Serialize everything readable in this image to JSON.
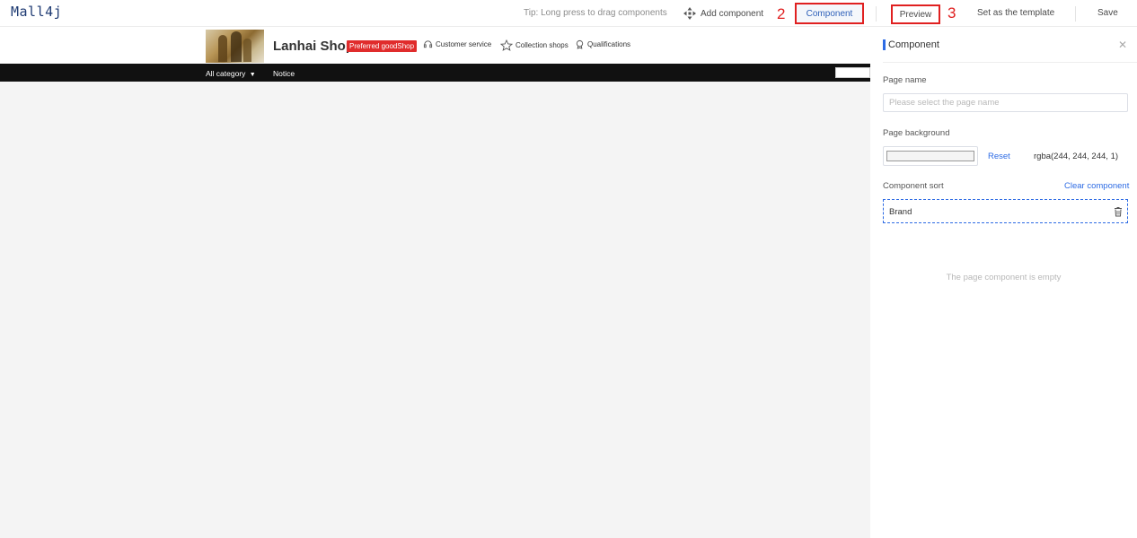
{
  "topbar": {
    "logo": "Mall4j",
    "tip": "Tip: Long press to drag components",
    "add_component": "Add component",
    "component": "Component",
    "preview": "Preview",
    "set_template": "Set as the template",
    "save": "Save",
    "annotation_component": "2",
    "annotation_preview": "3",
    "annotation_color": "#e02020"
  },
  "shop": {
    "name": "Lanhai Shop",
    "badge": "Preferred goodShop",
    "links": [
      "Customer service",
      "Collection shops",
      "Qualifications"
    ],
    "nav": [
      "All category",
      "Notice"
    ],
    "canvas_background": "#f4f4f4"
  },
  "panel": {
    "title": "Component",
    "close_icon": "close-icon",
    "page_name_label": "Page name",
    "page_name_placeholder": "Please select the page name",
    "page_background_label": "Page background",
    "reset": "Reset",
    "color_value": "rgba(244, 244, 244, 1)",
    "component_sort_label": "Component sort",
    "clear_component": "Clear component",
    "sort_items": [
      "Brand"
    ],
    "empty_text": "The page component is empty",
    "accent_color": "#2d6be4"
  }
}
